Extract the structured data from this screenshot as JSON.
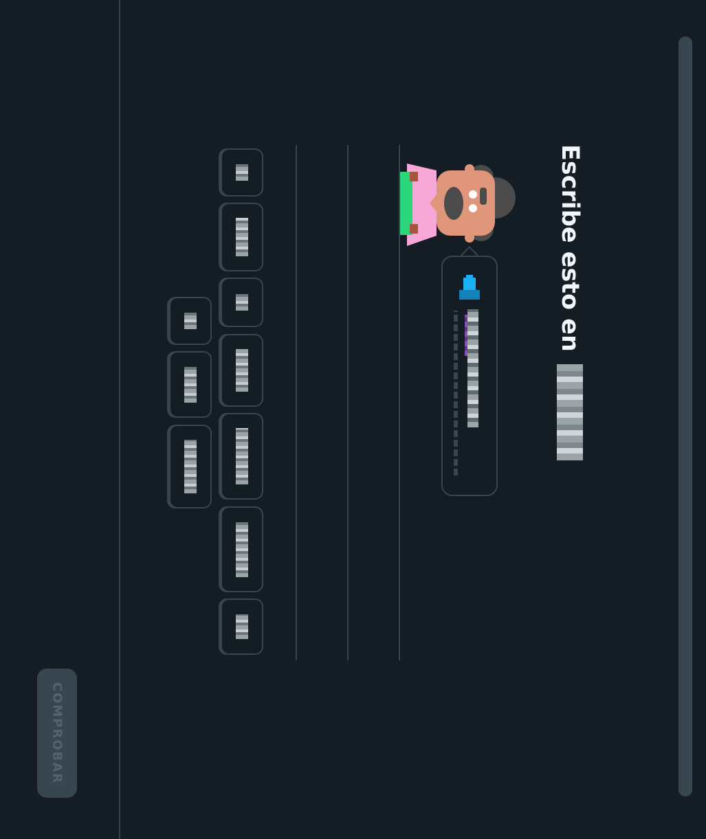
{
  "exercise": {
    "title": "Escribe esto en",
    "target_language": "",
    "prompt_sentence": ""
  },
  "check_button": {
    "label": "COMPROBAR"
  },
  "word_bank": [
    {
      "label": ""
    },
    {
      "label": ""
    },
    {
      "label": ""
    },
    {
      "label": ""
    },
    {
      "label": ""
    },
    {
      "label": ""
    },
    {
      "label": ""
    },
    {
      "label": ""
    },
    {
      "label": ""
    },
    {
      "label": ""
    }
  ],
  "colors": {
    "background": "#141d24",
    "border": "#37464f",
    "title": "#f1f7fb",
    "button_disabled": "#37464f",
    "speaker": "#1cb0f6",
    "highlight": "#8b4fb8"
  },
  "icons": {
    "speaker": "speaker-icon",
    "character": "character-avatar"
  }
}
